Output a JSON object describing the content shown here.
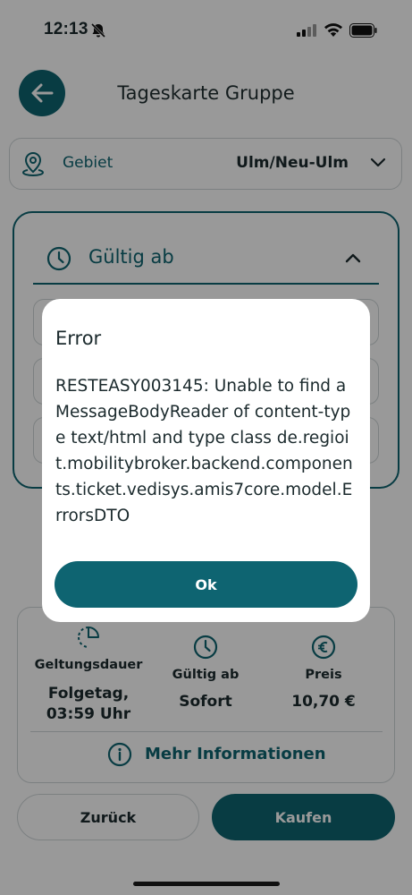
{
  "status_bar": {
    "time": "12:13"
  },
  "header": {
    "title": "Tageskarte Gruppe"
  },
  "area": {
    "label": "Gebiet",
    "value": "Ulm/Neu-Ulm"
  },
  "validity": {
    "label": "Gültig ab"
  },
  "summary": {
    "duration_label": "Geltungsdauer",
    "duration_value_line1": "Folgetag,",
    "duration_value_line2": "03:59 Uhr",
    "valid_from_label": "Gültig ab",
    "valid_from_value": "Sofort",
    "price_label": "Preis",
    "price_value": "10,70 €",
    "more_info": "Mehr Informationen"
  },
  "buttons": {
    "back": "Zurück",
    "buy": "Kaufen"
  },
  "dialog": {
    "title": "Error",
    "message": "RESTEASY003145: Unable to find a MessageBodyReader of content-type text/html and type class de.regioit.mobilitybroker.backend.components.ticket.vedisys.amis7core.model.ErrorsDTO",
    "ok": "Ok"
  },
  "colors": {
    "accent": "#0e6471"
  }
}
